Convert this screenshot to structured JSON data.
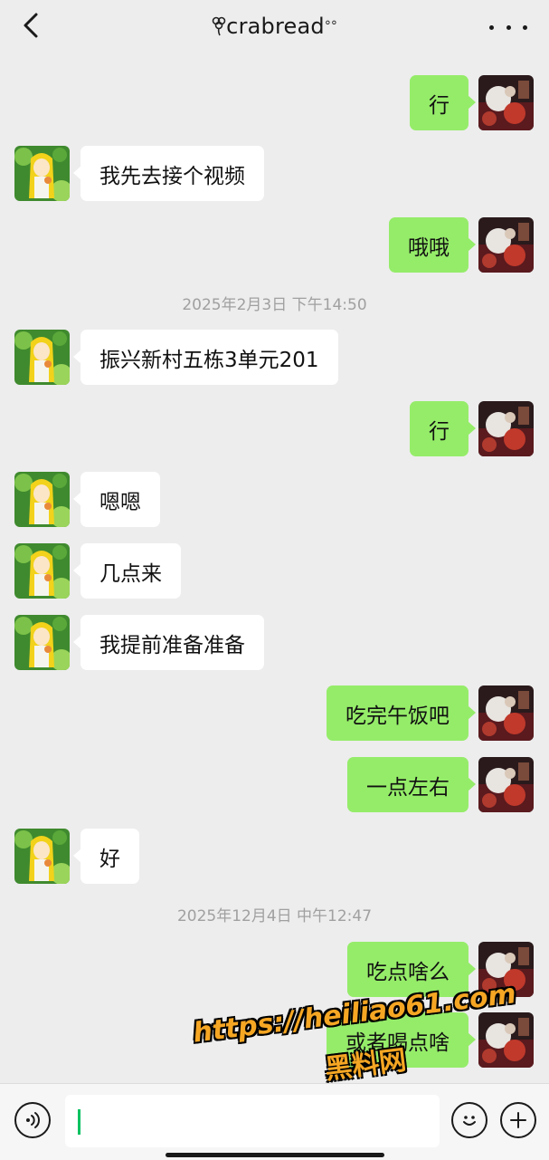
{
  "header": {
    "title": "crabread",
    "title_prefix_icon": "flower-icon",
    "title_suffix": "°°"
  },
  "messages": [
    {
      "side": "right",
      "text": "行"
    },
    {
      "side": "left",
      "text": "我先去接个视频"
    },
    {
      "side": "right",
      "text": "哦哦"
    },
    {
      "type": "time",
      "text": "2025年2月3日 下午14:50"
    },
    {
      "side": "left",
      "text": "振兴新村五栋3单元201"
    },
    {
      "side": "right",
      "text": "行"
    },
    {
      "side": "left",
      "text": "嗯嗯"
    },
    {
      "side": "left",
      "text": "几点来"
    },
    {
      "side": "left",
      "text": "我提前准备准备"
    },
    {
      "side": "right",
      "text": "吃完午饭吧"
    },
    {
      "side": "right",
      "text": "一点左右"
    },
    {
      "side": "left",
      "text": "好"
    },
    {
      "type": "time",
      "text": "2025年12月4日 中午12:47"
    },
    {
      "side": "right",
      "text": "吃点啥么"
    },
    {
      "side": "right",
      "text": "或者喝点啥"
    }
  ],
  "watermark": {
    "url": "https://heiliao61.com",
    "name": "黑料网"
  },
  "input": {
    "placeholder": ""
  },
  "colors": {
    "background": "#ededed",
    "self_bubble": "#95ec69",
    "other_bubble": "#ffffff",
    "caret": "#07c160"
  }
}
